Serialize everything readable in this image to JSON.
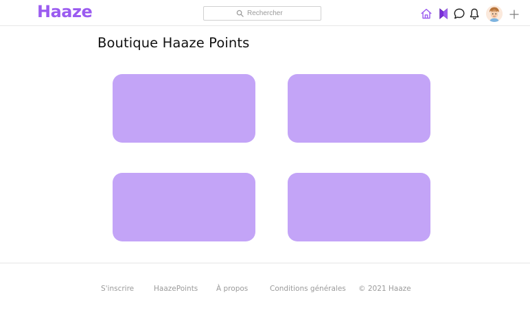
{
  "header": {
    "logo_text": "Haaze",
    "search": {
      "placeholder": "Rechercher",
      "value": ""
    },
    "nav_icons": [
      "home-icon",
      "haaze-points-icon",
      "chat-icon",
      "bell-icon",
      "avatar",
      "plus-icon"
    ]
  },
  "main": {
    "title": "Boutique Haaze Points",
    "cards": [
      {
        "label": ""
      },
      {
        "label": ""
      },
      {
        "label": ""
      },
      {
        "label": ""
      }
    ]
  },
  "footer": {
    "links": [
      "S'inscrire",
      "HaazePoints",
      "À propos",
      "Conditions générales"
    ],
    "copyright": "© 2021 Haaze"
  },
  "colors": {
    "brand": "#9b5cf0",
    "card": "#c3a4f7",
    "icon_dark": "#222222",
    "footer_text": "#9a9a9a"
  }
}
